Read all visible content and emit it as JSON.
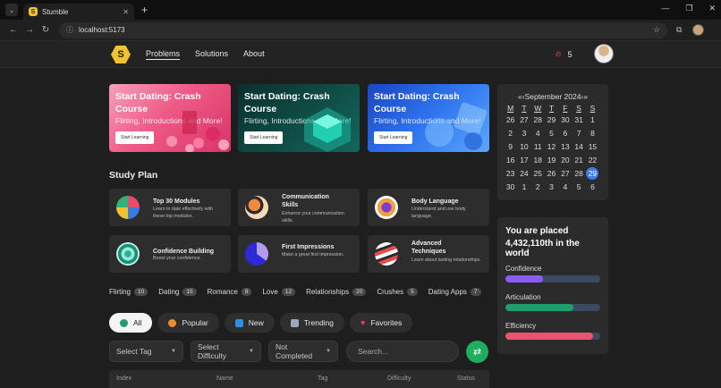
{
  "browser": {
    "tab_title": "Stumble",
    "url": "localhost:5173"
  },
  "nav": {
    "links": [
      "Problems",
      "Solutions",
      "About"
    ],
    "active": "Problems",
    "streak": "5"
  },
  "banners": [
    {
      "title": "Start Dating: Crash Course",
      "subtitle": "Flirting, Introductions and More!",
      "button": "Start Learning"
    },
    {
      "title": "Start Dating: Crash Course",
      "subtitle": "Flirting, Introductions and More!",
      "button": "Start Learning"
    },
    {
      "title": "Start Dating: Crash Course",
      "subtitle": "Flirting, Introductions and More!",
      "button": "Start Learning"
    }
  ],
  "study_plan": {
    "title": "Study Plan",
    "cards": [
      {
        "title": "Top 30 Modules",
        "desc": "Learn to date effectively with these top modules."
      },
      {
        "title": "Communication Skills",
        "desc": "Enhance your communication skills."
      },
      {
        "title": "Body Language",
        "desc": "Understand and use body language."
      },
      {
        "title": "Confidence Building",
        "desc": "Boost your confidence."
      },
      {
        "title": "First Impressions",
        "desc": "Make a great first impression."
      },
      {
        "title": "Advanced Techniques",
        "desc": "Learn about lasting relationships."
      }
    ]
  },
  "tags": [
    {
      "name": "Flirting",
      "count": "10"
    },
    {
      "name": "Dating",
      "count": "15"
    },
    {
      "name": "Romance",
      "count": "8"
    },
    {
      "name": "Love",
      "count": "12"
    },
    {
      "name": "Relationships",
      "count": "20"
    },
    {
      "name": "Crushes",
      "count": "5"
    },
    {
      "name": "Dating Apps",
      "count": "7"
    }
  ],
  "pills": [
    "All",
    "Popular",
    "New",
    "Trending",
    "Favorites"
  ],
  "filters": {
    "tag": "Select Tag",
    "difficulty": "Select Difficulty",
    "status": "Not Completed",
    "search_placeholder": "Search..."
  },
  "table": {
    "headers": [
      "Index",
      "Name",
      "Tag",
      "Difficulty",
      "Status"
    ]
  },
  "calendar": {
    "header": "«‹September 2024›»",
    "days": [
      "M",
      "T",
      "W",
      "T",
      "F",
      "S",
      "S"
    ],
    "weeks": [
      [
        "26",
        "27",
        "28",
        "29",
        "30",
        "31",
        "1"
      ],
      [
        "2",
        "3",
        "4",
        "5",
        "6",
        "7",
        "8"
      ],
      [
        "9",
        "10",
        "11",
        "12",
        "13",
        "14",
        "15"
      ],
      [
        "16",
        "17",
        "18",
        "19",
        "20",
        "21",
        "22"
      ],
      [
        "23",
        "24",
        "25",
        "26",
        "27",
        "28",
        "29"
      ],
      [
        "30",
        "1",
        "2",
        "3",
        "4",
        "5",
        "6"
      ]
    ],
    "today": "29"
  },
  "rank": {
    "line1": "You are placed",
    "line2": "4,432,110th in the world",
    "metrics": [
      {
        "label": "Confidence",
        "value": 0.4,
        "color": "#8b5cf6"
      },
      {
        "label": "Articulation",
        "value": 0.72,
        "color": "#1f9d6a"
      },
      {
        "label": "Efficiency",
        "value": 0.92,
        "color": "#e8556f"
      }
    ]
  }
}
